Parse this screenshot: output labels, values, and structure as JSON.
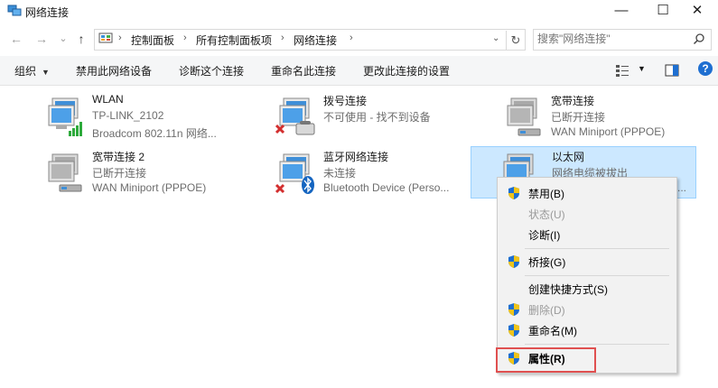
{
  "window": {
    "title": "网络连接",
    "minimize": "—",
    "maximize": "☐",
    "close": "✕"
  },
  "nav": {
    "back": "←",
    "forward": "→",
    "recent": "⌄",
    "up": "↑",
    "refresh": "↻",
    "dropdown": "⌄"
  },
  "breadcrumb": [
    "控制面板",
    "所有控制面板项",
    "网络连接"
  ],
  "search": {
    "placeholder": "搜索\"网络连接\""
  },
  "toolbar": {
    "organize": "组织",
    "disable": "禁用此网络设备",
    "diagnose": "诊断这个连接",
    "rename": "重命名此连接",
    "change_settings": "更改此连接的设置",
    "help": "?"
  },
  "connections": [
    {
      "name": "WLAN",
      "status": "TP-LINK_2102",
      "device": "Broadcom 802.11n 网络..."
    },
    {
      "name": "拨号连接",
      "status": "不可使用 - 找不到设备",
      "device": ""
    },
    {
      "name": "宽带连接",
      "status": "已断开连接",
      "device": "WAN Miniport (PPPOE)"
    },
    {
      "name": "宽带连接 2",
      "status": "已断开连接",
      "device": "WAN Miniport (PPPOE)"
    },
    {
      "name": "蓝牙网络连接",
      "status": "未连接",
      "device": "Bluetooth Device (Perso..."
    },
    {
      "name": "以太网",
      "status": "网络电缆被拔出",
      "device": "..."
    }
  ],
  "context_menu": {
    "disable": "禁用(B)",
    "status": "状态(U)",
    "diagnose": "诊断(I)",
    "bridge": "桥接(G)",
    "shortcut": "创建快捷方式(S)",
    "delete": "删除(D)",
    "rename": "重命名(M)",
    "properties": "属性(R)"
  },
  "colors": {
    "selection": "#cce8ff",
    "highlight_box": "#e05050",
    "help_blue": "#1e6fd1"
  }
}
